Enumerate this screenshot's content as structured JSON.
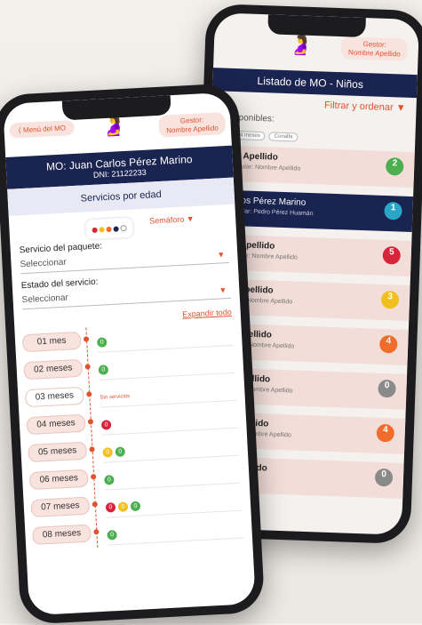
{
  "colors": {
    "navy": "#1a2450",
    "accent": "#e0532f",
    "green": "#4caf50",
    "red": "#d6243a",
    "yellow": "#f2c01e",
    "orange": "#ef6c2a",
    "gray": "#8a8a8a",
    "blue": "#2aa6c9"
  },
  "back": {
    "gestor": "Gestor:\nNombre Apellido",
    "figure_icon": "mother-child-icon",
    "title": "Listado de MO - Niños",
    "filter": "Filtrar y ordenar",
    "available": "s disponibles:",
    "chips": [
      "12 a 24 meses",
      "Conalfa"
    ],
    "rows": [
      {
        "name": "mbre Apellido",
        "sub": "233 - Titular: Nombre Apellido",
        "alert": "2",
        "color": "green"
      },
      {
        "name": "n Carlos Pérez Marino",
        "sub": "233 - Titular: Pedro Pérez Huamán",
        "alert": "1",
        "color": "blue",
        "selected": true
      },
      {
        "name": "mbre Apellido",
        "sub": "233 - Titular: Nombre Apellido",
        "alert": "5",
        "color": "red"
      },
      {
        "name": "mbre Apellido",
        "sub": "78 - Titular: Nombre Apellido",
        "alert": "3",
        "color": "yellow"
      },
      {
        "name": "mbre Apellido",
        "sub": "233 - Titular: Nombre Apellido",
        "alert": "4",
        "color": "orange"
      },
      {
        "name": "mbre Apellido",
        "sub": "233 - Titular: Nombre Apellido",
        "alert": "0",
        "color": "gray"
      },
      {
        "name": "mbre Apellido",
        "sub": "233 - Titular: Nombre Apellido",
        "alert": "4",
        "color": "orange"
      },
      {
        "name": "mbre Apellido",
        "sub": "",
        "alert": "0",
        "color": "gray"
      }
    ]
  },
  "front": {
    "menu": "Menú del MO",
    "gestor": "Gestor:\nNombre Apellido",
    "mo_name": "MO: Juan Carlos Pérez Marino",
    "dni": "DNI: 21122233",
    "services_title": "Servicios por edad",
    "semaforo": "Semáforo",
    "package_label": "Servicio del paquete:",
    "package_value": "Seleccionar",
    "state_label": "Estado del servicio:",
    "state_value": "Seleccionar",
    "expand": "Expandir todo",
    "months": [
      {
        "label": "01 mes",
        "services": [
          {
            "color": "green",
            "n": "0"
          }
        ]
      },
      {
        "label": "02 meses",
        "services": [
          {
            "color": "green",
            "n": "0"
          }
        ]
      },
      {
        "label": "03 meses",
        "none": "Sin servicios"
      },
      {
        "label": "04 meses",
        "services": [
          {
            "color": "red",
            "n": "0"
          }
        ]
      },
      {
        "label": "05 meses",
        "services": [
          {
            "color": "yellow",
            "n": "0"
          },
          {
            "color": "green",
            "n": "0"
          }
        ]
      },
      {
        "label": "06 meses",
        "services": [
          {
            "color": "green",
            "n": "0"
          }
        ]
      },
      {
        "label": "07 meses",
        "services": [
          {
            "color": "red",
            "n": "0"
          },
          {
            "color": "yellow",
            "n": "0"
          },
          {
            "color": "green",
            "n": "0"
          }
        ]
      },
      {
        "label": "08 meses",
        "services": [
          {
            "color": "green",
            "n": "0"
          }
        ]
      }
    ]
  }
}
